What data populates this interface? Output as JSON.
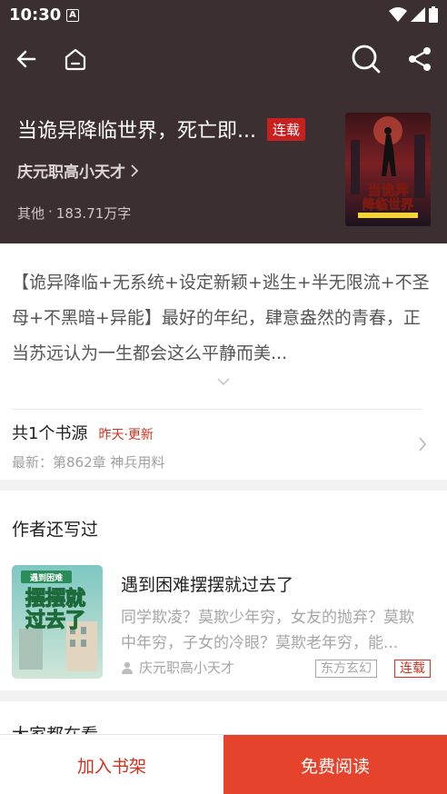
{
  "status_bar": {
    "time": "10:30",
    "notification_letter": "A"
  },
  "book": {
    "title": "当诡异降临世界，死亡即...",
    "status_badge": "连载",
    "author": "庆元职高小天才",
    "category": "其他",
    "separator": "·",
    "word_count": "183.71万字",
    "cover_title": "当诡异降临世界"
  },
  "intro": {
    "text": "【诡异降临+无系统+设定新颖+逃生+半无限流+不圣母+不黑暗+异能】最好的年纪，肆意盎然的青春，正当苏远认为一生都会这么平静而美..."
  },
  "source": {
    "title": "共1个书源",
    "update": "昨天·更新",
    "latest": "最新：第862章 神兵用料"
  },
  "author_works": {
    "heading": "作者还写过",
    "items": [
      {
        "title": "遇到困难摆摆就过去了",
        "description": "同学欺凌？莫欺少年穷，女友的抛弃？莫欺中年穷，子女的冷眼？莫欺老年穷，能...",
        "author": "庆元职高小天才",
        "genre": "东方玄幻",
        "status": "连载",
        "cover_label_top": "遇到困难",
        "cover_label_main": "摆摆就过去了"
      }
    ]
  },
  "more": {
    "heading": "大家都在看"
  },
  "bottom_bar": {
    "add_shelf": "加入书架",
    "free_read": "免费阅读"
  },
  "colors": {
    "hero_bg": "#3b2f31",
    "accent_red": "#e5432c",
    "badge_red": "#c8201e"
  }
}
